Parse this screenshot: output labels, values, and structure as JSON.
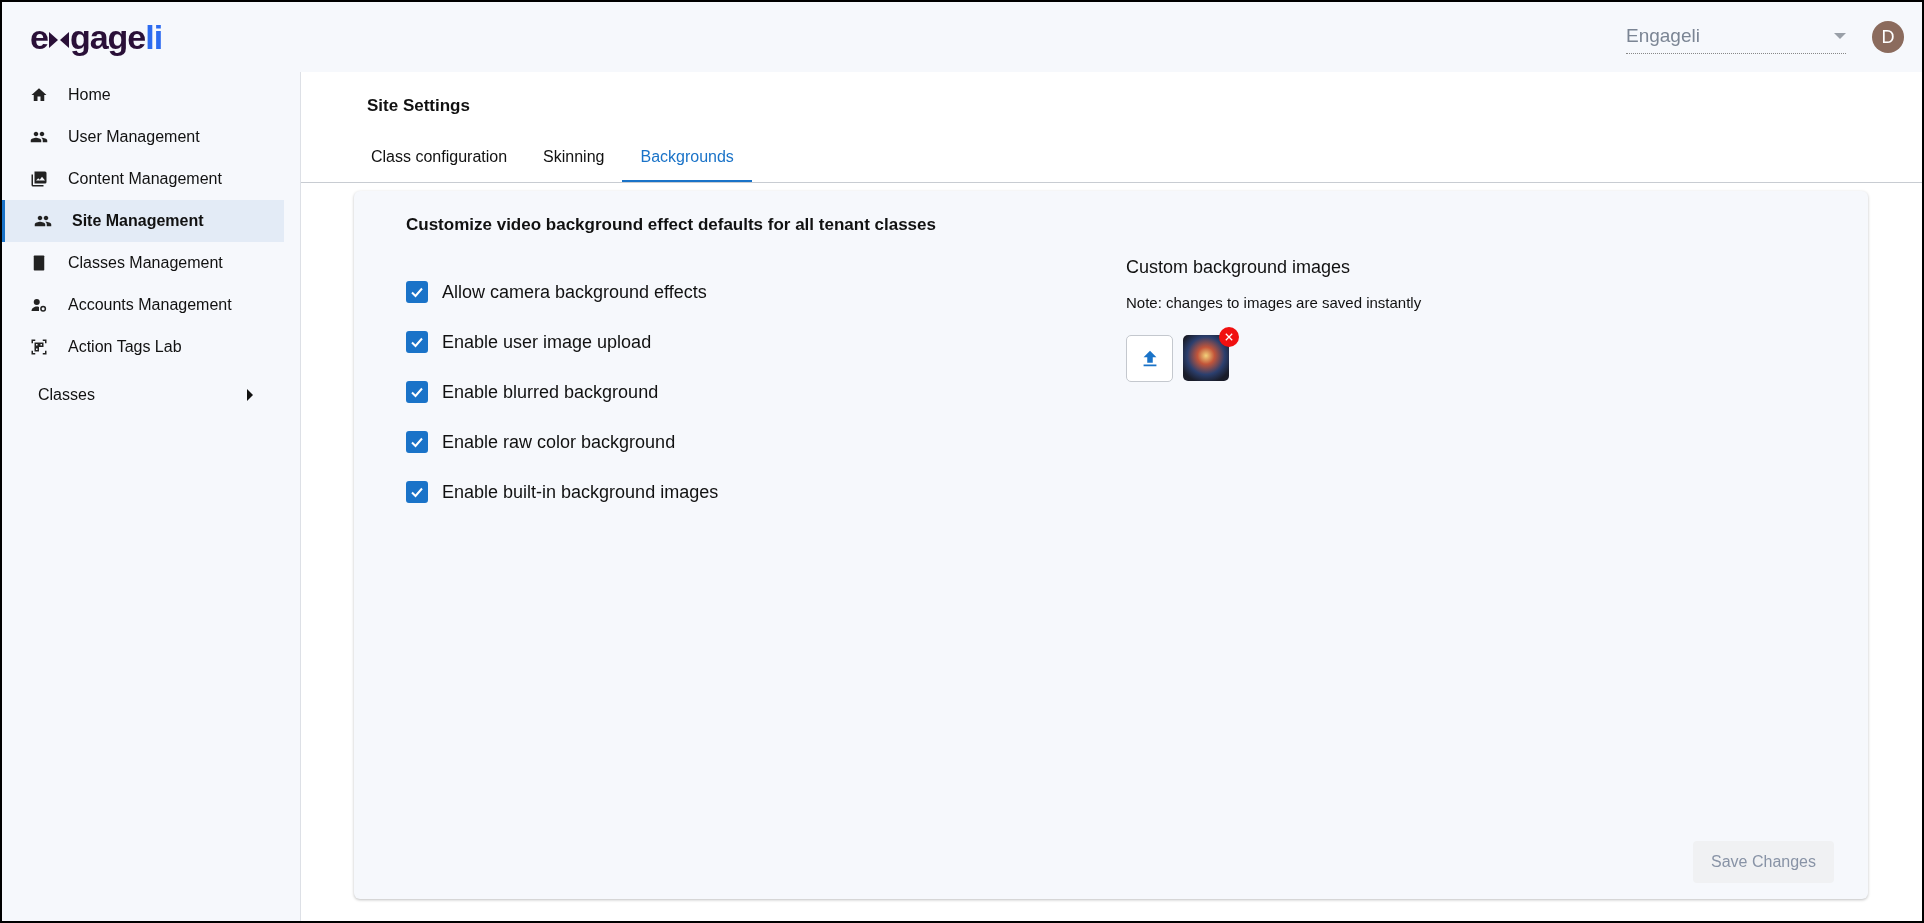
{
  "logo": {
    "lead": "e",
    "main": "gage",
    "accent": "li"
  },
  "header": {
    "tenant_select": {
      "value": "Engageli"
    },
    "avatar": {
      "initial": "D"
    }
  },
  "sidebar": {
    "items": [
      {
        "label": "Home",
        "kind": "home",
        "selected": false
      },
      {
        "label": "User Management",
        "kind": "people",
        "selected": false
      },
      {
        "label": "Content Management",
        "kind": "media",
        "selected": false
      },
      {
        "label": "Site Management",
        "kind": "people",
        "selected": true
      },
      {
        "label": "Classes Management",
        "kind": "book",
        "selected": false
      },
      {
        "label": "Accounts Management",
        "kind": "account",
        "selected": false
      },
      {
        "label": "Action Tags Lab",
        "kind": "tags",
        "selected": false
      }
    ],
    "section": {
      "label": "Classes",
      "expanded": false
    }
  },
  "page": {
    "title": "Site Settings",
    "tabs": [
      {
        "label": "Class configuration",
        "selected": false
      },
      {
        "label": "Skinning",
        "selected": false
      },
      {
        "label": "Backgrounds",
        "selected": true
      }
    ]
  },
  "card": {
    "heading": "Customize video background effect defaults for all tenant classes",
    "options": [
      {
        "label": "Allow camera background effects",
        "checked": true
      },
      {
        "label": "Enable user image upload",
        "checked": true
      },
      {
        "label": "Enable blurred background",
        "checked": true
      },
      {
        "label": "Enable raw color background",
        "checked": true
      },
      {
        "label": "Enable built-in background images",
        "checked": true
      }
    ],
    "custom_images": {
      "title": "Custom background images",
      "note": "Note: changes to images are saved instantly",
      "images": [
        {
          "removable": true
        }
      ]
    },
    "save_button": {
      "label": "Save Changes",
      "disabled": true
    }
  }
}
